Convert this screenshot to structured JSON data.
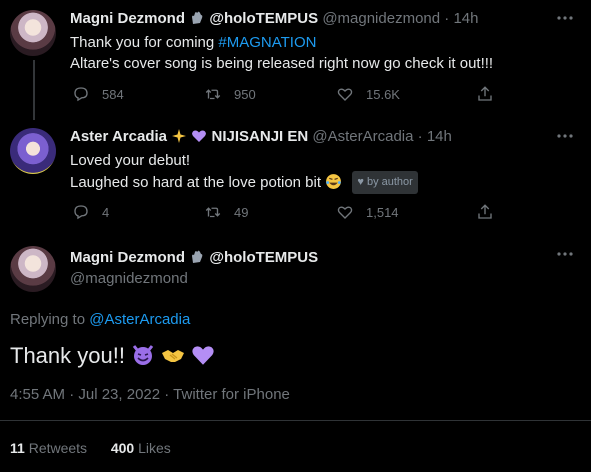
{
  "tweets": [
    {
      "name": "Magni Dezmond",
      "handle_display": "@holoTEMPUS",
      "handle": "@magnidezmond",
      "time": "14h",
      "line1_prefix": "Thank you for coming ",
      "line1_hashtag": "#MAGNATION",
      "line2": "Altare's cover song is being released right now go check it out!!!",
      "replies": "584",
      "retweets": "950",
      "likes": "15.6K"
    },
    {
      "name": "Aster Arcadia",
      "affiliation": "NIJISANJI EN",
      "handle": "@AsterArcadia",
      "time": "14h",
      "line1": "Loved your debut!",
      "line2": "Laughed so hard at the love potion bit",
      "badge": "by author",
      "replies": "4",
      "retweets": "49",
      "likes": "1,514"
    }
  ],
  "main": {
    "name": "Magni Dezmond",
    "handle_display": "@holoTEMPUS",
    "handle": "@magnidezmond",
    "replying_prefix": "Replying to ",
    "replying_to": "@AsterArcadia",
    "text": "Thank you!!",
    "timestamp": "4:55 AM · Jul 23, 2022 · Twitter for iPhone",
    "retweets_count": "11",
    "retweets_label": "Retweets",
    "likes_count": "400",
    "likes_label": "Likes"
  },
  "colors": {
    "background": "#000000",
    "text": "#e7e9ea",
    "muted": "#71767b",
    "link": "#1d9bf0",
    "heart_emoji": "#b48ef5"
  },
  "icons": [
    "reply-icon",
    "retweet-icon",
    "like-icon",
    "share-icon",
    "more-icon",
    "heart-badge-icon",
    "hand-emoji-icon",
    "purple-heart-emoji-icon",
    "devil-emoji-icon",
    "handshake-emoji-icon",
    "laughing-emoji-icon",
    "sparkle-emoji-icon"
  ]
}
